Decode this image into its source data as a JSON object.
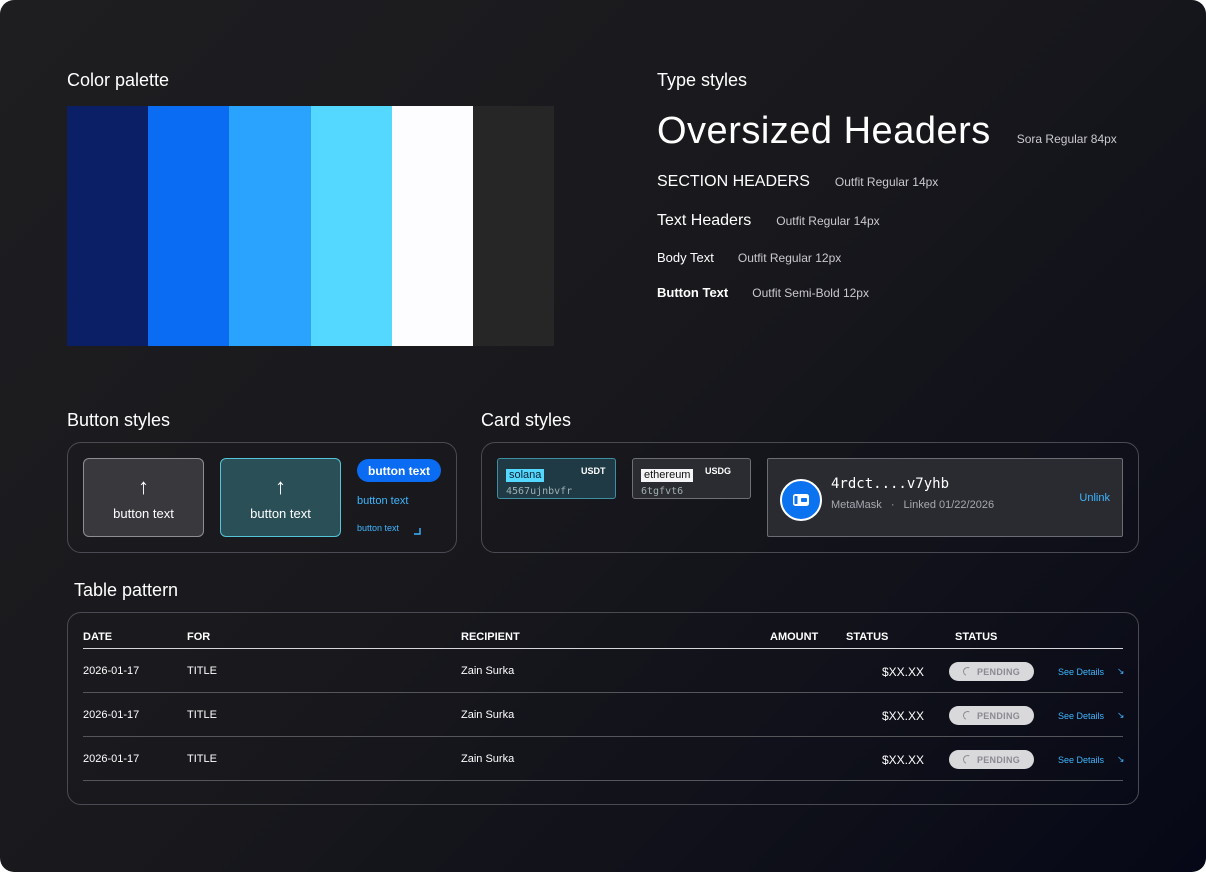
{
  "sections": {
    "color_palette": "Color palette",
    "type_styles": "Type styles",
    "button_styles": "Button styles",
    "card_styles": "Card styles",
    "table_pattern": "Table pattern"
  },
  "palette": [
    "#0a1f66",
    "#0a6cf2",
    "#2aa3ff",
    "#55d8ff",
    "#fdfdff",
    "#262626"
  ],
  "type_styles": [
    {
      "sample": "Oversized Headers",
      "desc": "Sora Regular 84px"
    },
    {
      "sample": "SECTION HEADERS",
      "desc": "Outfit Regular 14px"
    },
    {
      "sample": "Text Headers",
      "desc": "Outfit Regular 14px"
    },
    {
      "sample": "Body Text",
      "desc": "Outfit Regular 12px"
    },
    {
      "sample": "Button Text",
      "desc": "Outfit Semi-Bold 12px"
    }
  ],
  "buttons": {
    "dark_label": "button text",
    "teal_label": "button text",
    "pill_label": "button text",
    "link_label": "button text",
    "small_link_label": "button text",
    "arrow_icon": "arrow-up-icon"
  },
  "cards": {
    "token1": {
      "chain": "solana",
      "symbol": "USDT",
      "address": "4567ujnbvfr"
    },
    "token2": {
      "chain": "ethereum",
      "symbol": "USDG",
      "address": "6tgfvt6"
    },
    "wallet": {
      "address": "4rdct....v7yhb",
      "provider": "MetaMask",
      "separator": "·",
      "linked": "Linked 01/22/2026",
      "action": "Unlink"
    }
  },
  "table": {
    "headers": [
      "DATE",
      "FOR",
      "RECIPIENT",
      "AMOUNT",
      "STATUS",
      "STATUS"
    ],
    "rows": [
      {
        "date": "2026-01-17",
        "for": "TITLE",
        "recipient": "Zain Surka",
        "amount": "$XX.XX",
        "status": "PENDING",
        "action": "See Details"
      },
      {
        "date": "2026-01-17",
        "for": "TITLE",
        "recipient": "Zain Surka",
        "amount": "$XX.XX",
        "status": "PENDING",
        "action": "See Details"
      },
      {
        "date": "2026-01-17",
        "for": "TITLE",
        "recipient": "Zain Surka",
        "amount": "$XX.XX",
        "status": "PENDING",
        "action": "See Details"
      }
    ]
  }
}
